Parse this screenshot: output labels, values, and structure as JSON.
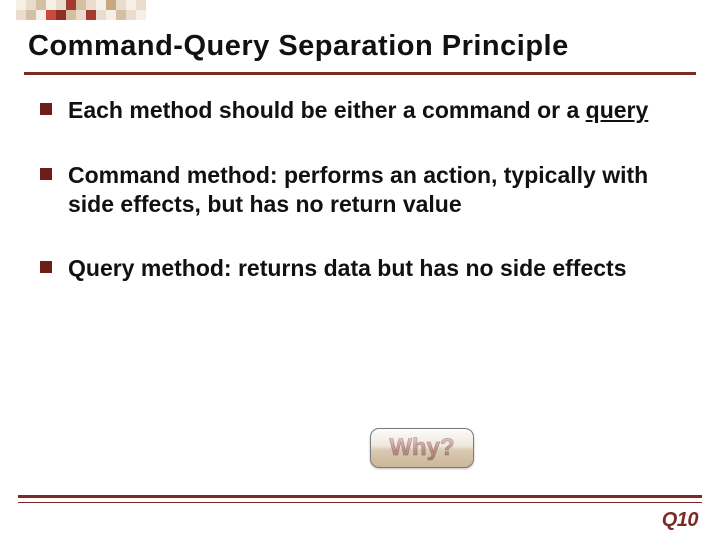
{
  "title": "Command-Query Separation Principle",
  "bullets": [
    {
      "pre": "Each ",
      "b1": "method",
      "mid1": " should be either a ",
      "b2": "command",
      "mid2": " or a ",
      "b3": "query",
      "post": ""
    },
    {
      "pre": "",
      "b1": "Command",
      "mid1": " method: performs an action, typically with side effects, but has no return value",
      "b2": "",
      "mid2": "",
      "b3": "",
      "post": ""
    },
    {
      "pre": "",
      "b1": "Query",
      "mid1": " method: returns data but has no side effects",
      "b2": "",
      "mid2": "",
      "b3": "",
      "post": ""
    }
  ],
  "button": {
    "label": "Why?"
  },
  "footer": {
    "q": "Q10"
  }
}
